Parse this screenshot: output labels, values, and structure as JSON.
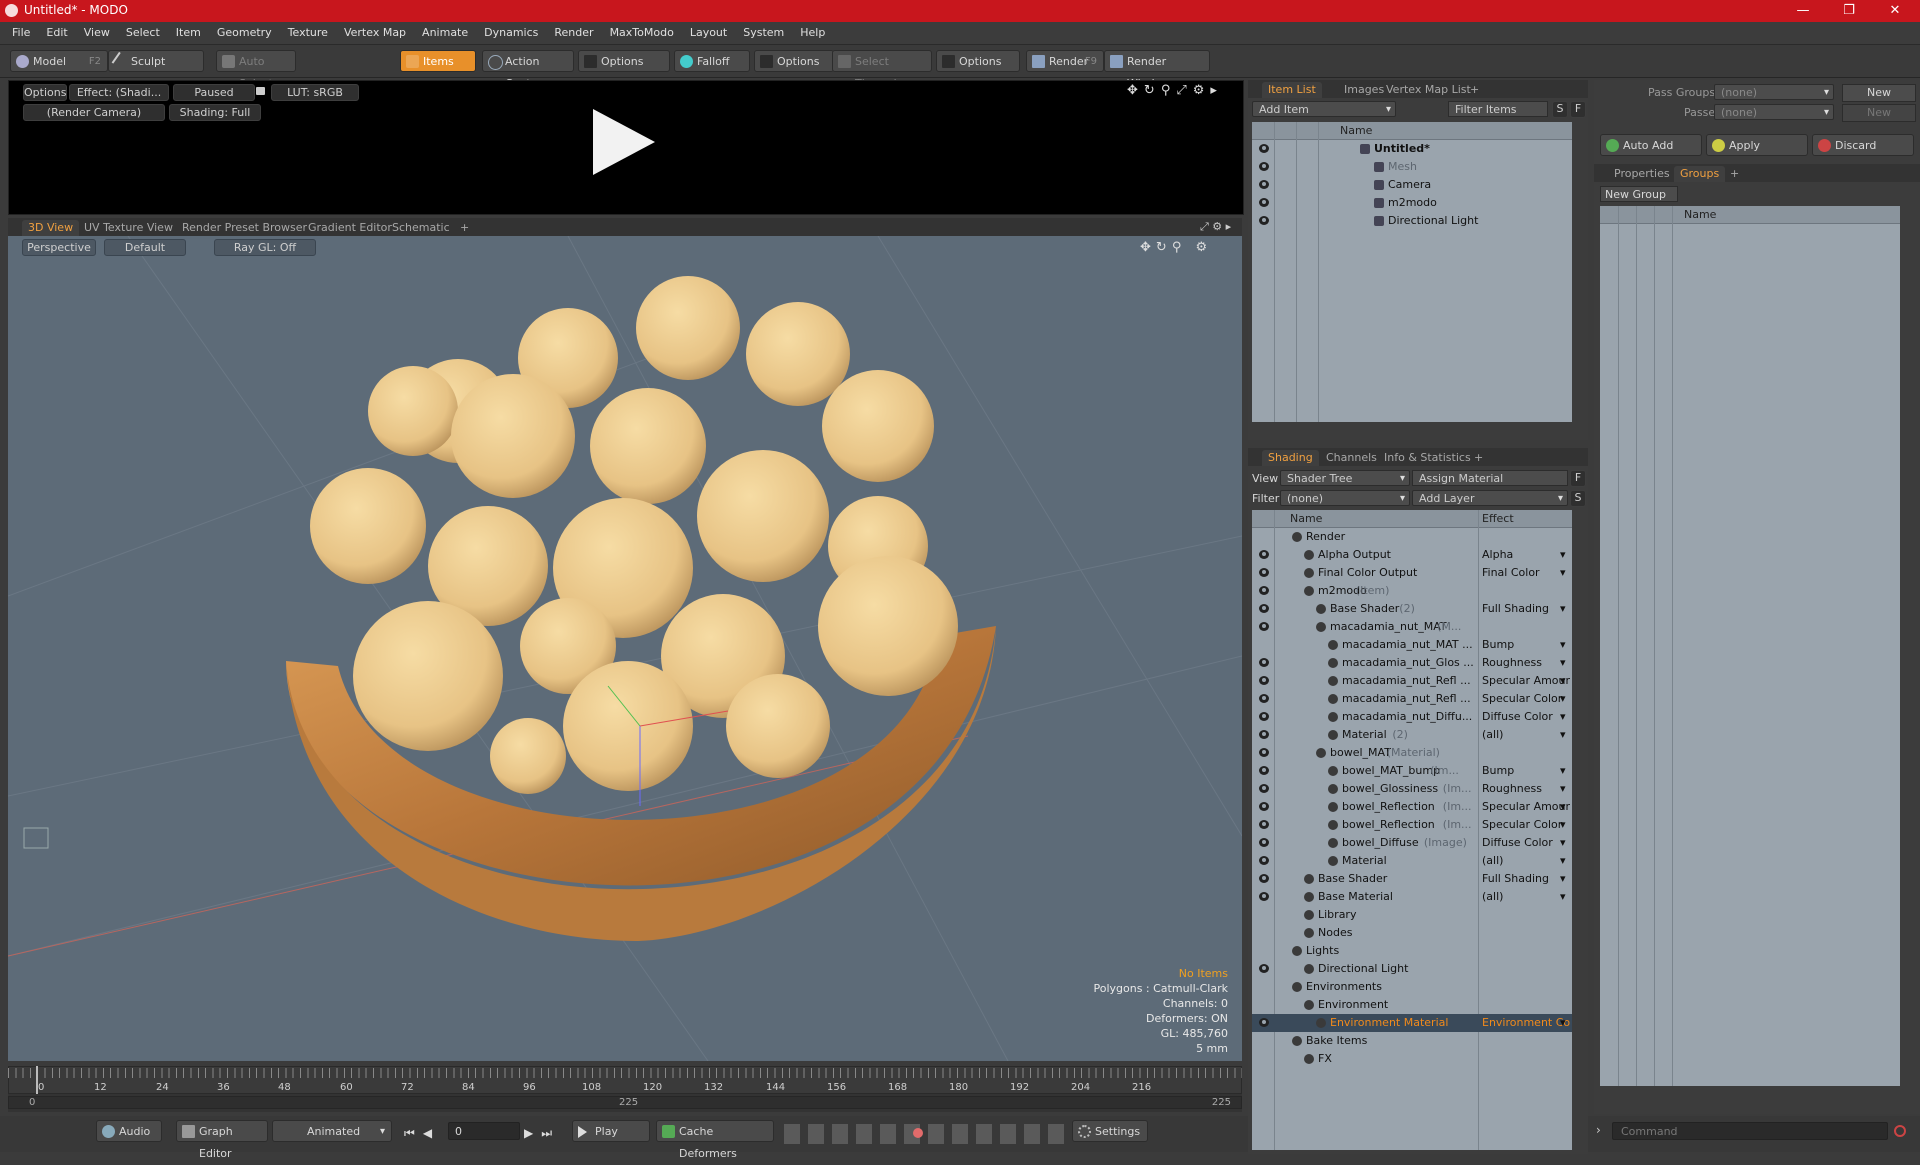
{
  "window": {
    "title": "Untitled* - MODO",
    "minimize": "—",
    "restore": "❐",
    "close": "✕"
  },
  "menu": [
    "File",
    "Edit",
    "View",
    "Select",
    "Item",
    "Geometry",
    "Texture",
    "Vertex Map",
    "Animate",
    "Dynamics",
    "Render",
    "MaxToModo",
    "Layout",
    "System",
    "Help"
  ],
  "toolbar": {
    "model": "Model",
    "model_key": "F2",
    "sculpt": "Sculpt",
    "auto_select": "Auto Select",
    "items": "Items",
    "action_center": "Action Center",
    "options1": "Options",
    "falloff": "Falloff",
    "options2": "Options",
    "select_through": "Select Through",
    "options3": "Options",
    "render": "Render",
    "render_key": "F9",
    "render_window": "Render Window"
  },
  "render_preview": {
    "options": "Options",
    "effect": "Effect: (Shadi...",
    "paused": "Paused",
    "lut": "LUT: sRGB",
    "camera": "(Render Camera)",
    "shading": "Shading: Full"
  },
  "viewport_tabs": [
    "3D View",
    "UV Texture View",
    "Render Preset Browser",
    "Gradient Editor",
    "Schematic"
  ],
  "viewport": {
    "projection": "Perspective",
    "style": "Default",
    "raygl": "Ray GL: Off",
    "stats": [
      "No Items",
      "Polygons : Catmull-Clark",
      "Channels: 0",
      "Deformers: ON",
      "GL: 485,760",
      "5 mm"
    ]
  },
  "timeline": {
    "ticks": [
      "0",
      "12",
      "24",
      "36",
      "48",
      "60",
      "72",
      "84",
      "96",
      "108",
      "120",
      "132",
      "144",
      "156",
      "168",
      "180",
      "192",
      "204",
      "216"
    ],
    "start": "0",
    "mid": "225",
    "end": "225"
  },
  "bottom": {
    "audio": "Audio",
    "graph_editor": "Graph Editor",
    "animated": "Animated",
    "frame": "0",
    "play": "Play",
    "cache": "Cache Deformers",
    "settings": "Settings",
    "command": "Command"
  },
  "item_list": {
    "tabs": [
      "Item List",
      "Images",
      "Vertex Map List"
    ],
    "add_item": "Add Item",
    "filter": "Filter Items",
    "s": "S",
    "f": "F",
    "name_header": "Name",
    "items": [
      {
        "label": "Untitled*",
        "indent": 0,
        "bold": true
      },
      {
        "label": "Mesh",
        "indent": 1,
        "gray": true
      },
      {
        "label": "Camera",
        "indent": 1
      },
      {
        "label": "m2modo",
        "indent": 1
      },
      {
        "label": "Directional Light",
        "indent": 1
      }
    ]
  },
  "shading": {
    "tabs": [
      "Shading",
      "Channels",
      "Info & Statistics"
    ],
    "view_label": "View",
    "view_value": "Shader Tree",
    "assign": "Assign Material",
    "f": "F",
    "filter_label": "Filter",
    "filter_value": "(none)",
    "add_layer": "Add Layer",
    "s": "S",
    "name_header": "Name",
    "effect_header": "Effect",
    "rows": [
      {
        "name": "Render",
        "suffix": "",
        "effect": "",
        "indent": 0,
        "eye": false
      },
      {
        "name": "Alpha Output",
        "suffix": "",
        "effect": "Alpha",
        "indent": 1,
        "eye": true
      },
      {
        "name": "Final Color Output",
        "suffix": "",
        "effect": "Final Color",
        "indent": 1,
        "eye": true
      },
      {
        "name": "m2modo",
        "suffix": " (Item)",
        "effect": "",
        "indent": 1,
        "eye": true
      },
      {
        "name": "Base Shader",
        "suffix": " (2)",
        "effect": "Full Shading",
        "indent": 2,
        "eye": true
      },
      {
        "name": "macadamia_nut_MAT",
        "suffix": " (M...",
        "effect": "",
        "indent": 2,
        "eye": true
      },
      {
        "name": "macadamia_nut_MAT ...",
        "suffix": "",
        "effect": "Bump",
        "indent": 3,
        "eye": false
      },
      {
        "name": "macadamia_nut_Glos ...",
        "suffix": "",
        "effect": "Roughness",
        "indent": 3,
        "eye": true
      },
      {
        "name": "macadamia_nut_Refl ...",
        "suffix": "",
        "effect": "Specular Amount",
        "indent": 3,
        "eye": true
      },
      {
        "name": "macadamia_nut_Refl ...",
        "suffix": "",
        "effect": "Specular Color",
        "indent": 3,
        "eye": true
      },
      {
        "name": "macadamia_nut_Diffu...",
        "suffix": "",
        "effect": "Diffuse Color",
        "indent": 3,
        "eye": true
      },
      {
        "name": "Material",
        "suffix": " (2)",
        "effect": "(all)",
        "indent": 3,
        "eye": true
      },
      {
        "name": "bowel_MAT",
        "suffix": " (Material)",
        "effect": "",
        "indent": 2,
        "eye": true
      },
      {
        "name": "bowel_MAT_bump",
        "suffix": " (Im...",
        "effect": "Bump",
        "indent": 3,
        "eye": true
      },
      {
        "name": "bowel_Glossiness",
        "suffix": " (Im...",
        "effect": "Roughness",
        "indent": 3,
        "eye": true
      },
      {
        "name": "bowel_Reflection",
        "suffix": " (Im...",
        "effect": "Specular Amount",
        "indent": 3,
        "eye": true
      },
      {
        "name": "bowel_Reflection",
        "suffix": " (Im...",
        "effect": "Specular Color",
        "indent": 3,
        "eye": true
      },
      {
        "name": "bowel_Diffuse",
        "suffix": " (Image)",
        "effect": "Diffuse Color",
        "indent": 3,
        "eye": true
      },
      {
        "name": "Material",
        "suffix": "",
        "effect": "(all)",
        "indent": 3,
        "eye": true
      },
      {
        "name": "Base Shader",
        "suffix": "",
        "effect": "Full Shading",
        "indent": 1,
        "eye": true
      },
      {
        "name": "Base Material",
        "suffix": "",
        "effect": "(all)",
        "indent": 1,
        "eye": true
      },
      {
        "name": "Library",
        "suffix": "",
        "effect": "",
        "indent": 1,
        "eye": false
      },
      {
        "name": "Nodes",
        "suffix": "",
        "effect": "",
        "indent": 1,
        "eye": false
      },
      {
        "name": "Lights",
        "suffix": "",
        "effect": "",
        "indent": 0,
        "eye": false
      },
      {
        "name": "Directional Light",
        "suffix": "",
        "effect": "",
        "indent": 1,
        "eye": true
      },
      {
        "name": "Environments",
        "suffix": "",
        "effect": "",
        "indent": 0,
        "eye": false
      },
      {
        "name": "Environment",
        "suffix": "",
        "effect": "",
        "indent": 1,
        "eye": false
      },
      {
        "name": "Environment Material",
        "suffix": "",
        "effect": "Environment Color",
        "indent": 2,
        "eye": true,
        "selected": true
      },
      {
        "name": "Bake Items",
        "suffix": "",
        "effect": "",
        "indent": 0,
        "eye": false
      },
      {
        "name": "FX",
        "suffix": "",
        "effect": "",
        "indent": 1,
        "eye": false
      }
    ]
  },
  "groups": {
    "pass_groups_label": "Pass Groups",
    "pass_groups_value": "(none)",
    "new1": "New",
    "passes_label": "Passes",
    "passes_value": "(none)",
    "new2": "New",
    "auto_add": "Auto Add",
    "apply": "Apply",
    "discard": "Discard",
    "tabs": [
      "Properties",
      "Groups"
    ],
    "new_group": "New Group",
    "name_header": "Name"
  },
  "colors": {
    "accent": "#e8902a",
    "title_bar": "#c8161d",
    "selected_text": "#f08a1c"
  }
}
